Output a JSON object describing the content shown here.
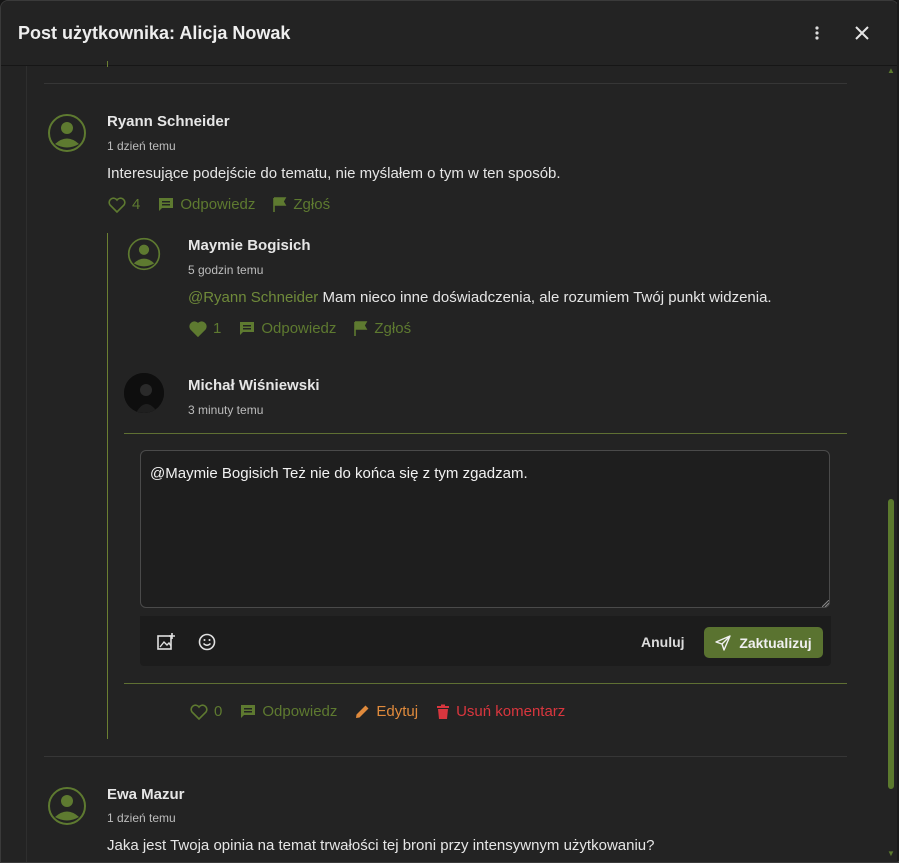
{
  "header": {
    "title": "Post użytkownika: Alicja Nowak",
    "more_icon": "more-vertical-icon",
    "close_icon": "close-icon"
  },
  "comments": [
    {
      "author": "Ryann Schneider",
      "time": "1 dzień temu",
      "text": "Interesujące podejście do tematu, nie myślałem o tym w ten sposób.",
      "likes": "4",
      "reply_label": "Odpowiedz",
      "report_label": "Zgłoś"
    },
    {
      "author": "Maymie Bogisich",
      "time": "5 godzin temu",
      "mention": "@Ryann Schneider",
      "text": "Mam nieco inne doświadczenia, ale rozumiem Twój punkt widzenia.",
      "likes": "1",
      "reply_label": "Odpowiedz",
      "report_label": "Zgłoś"
    },
    {
      "author": "Michał Wiśniewski",
      "time": "3 minuty temu",
      "likes": "0",
      "reply_label": "Odpowiedz",
      "edit_label": "Edytuj",
      "delete_label": "Usuń komentarz"
    },
    {
      "author": "Ewa Mazur",
      "time": "1 dzień temu",
      "text": "Jaka jest Twoja opinia na temat trwałości tej broni przy intensywnym użytkowaniu?"
    }
  ],
  "editor": {
    "value": "@Maymie Bogisich Też nie do końca się z tym zgadzam.",
    "cancel_label": "Anuluj",
    "update_label": "Zaktualizuj"
  },
  "colors": {
    "accent": "#5a7330",
    "link": "#5e7a30",
    "edit": "#e08a3c",
    "delete": "#d9363e"
  }
}
